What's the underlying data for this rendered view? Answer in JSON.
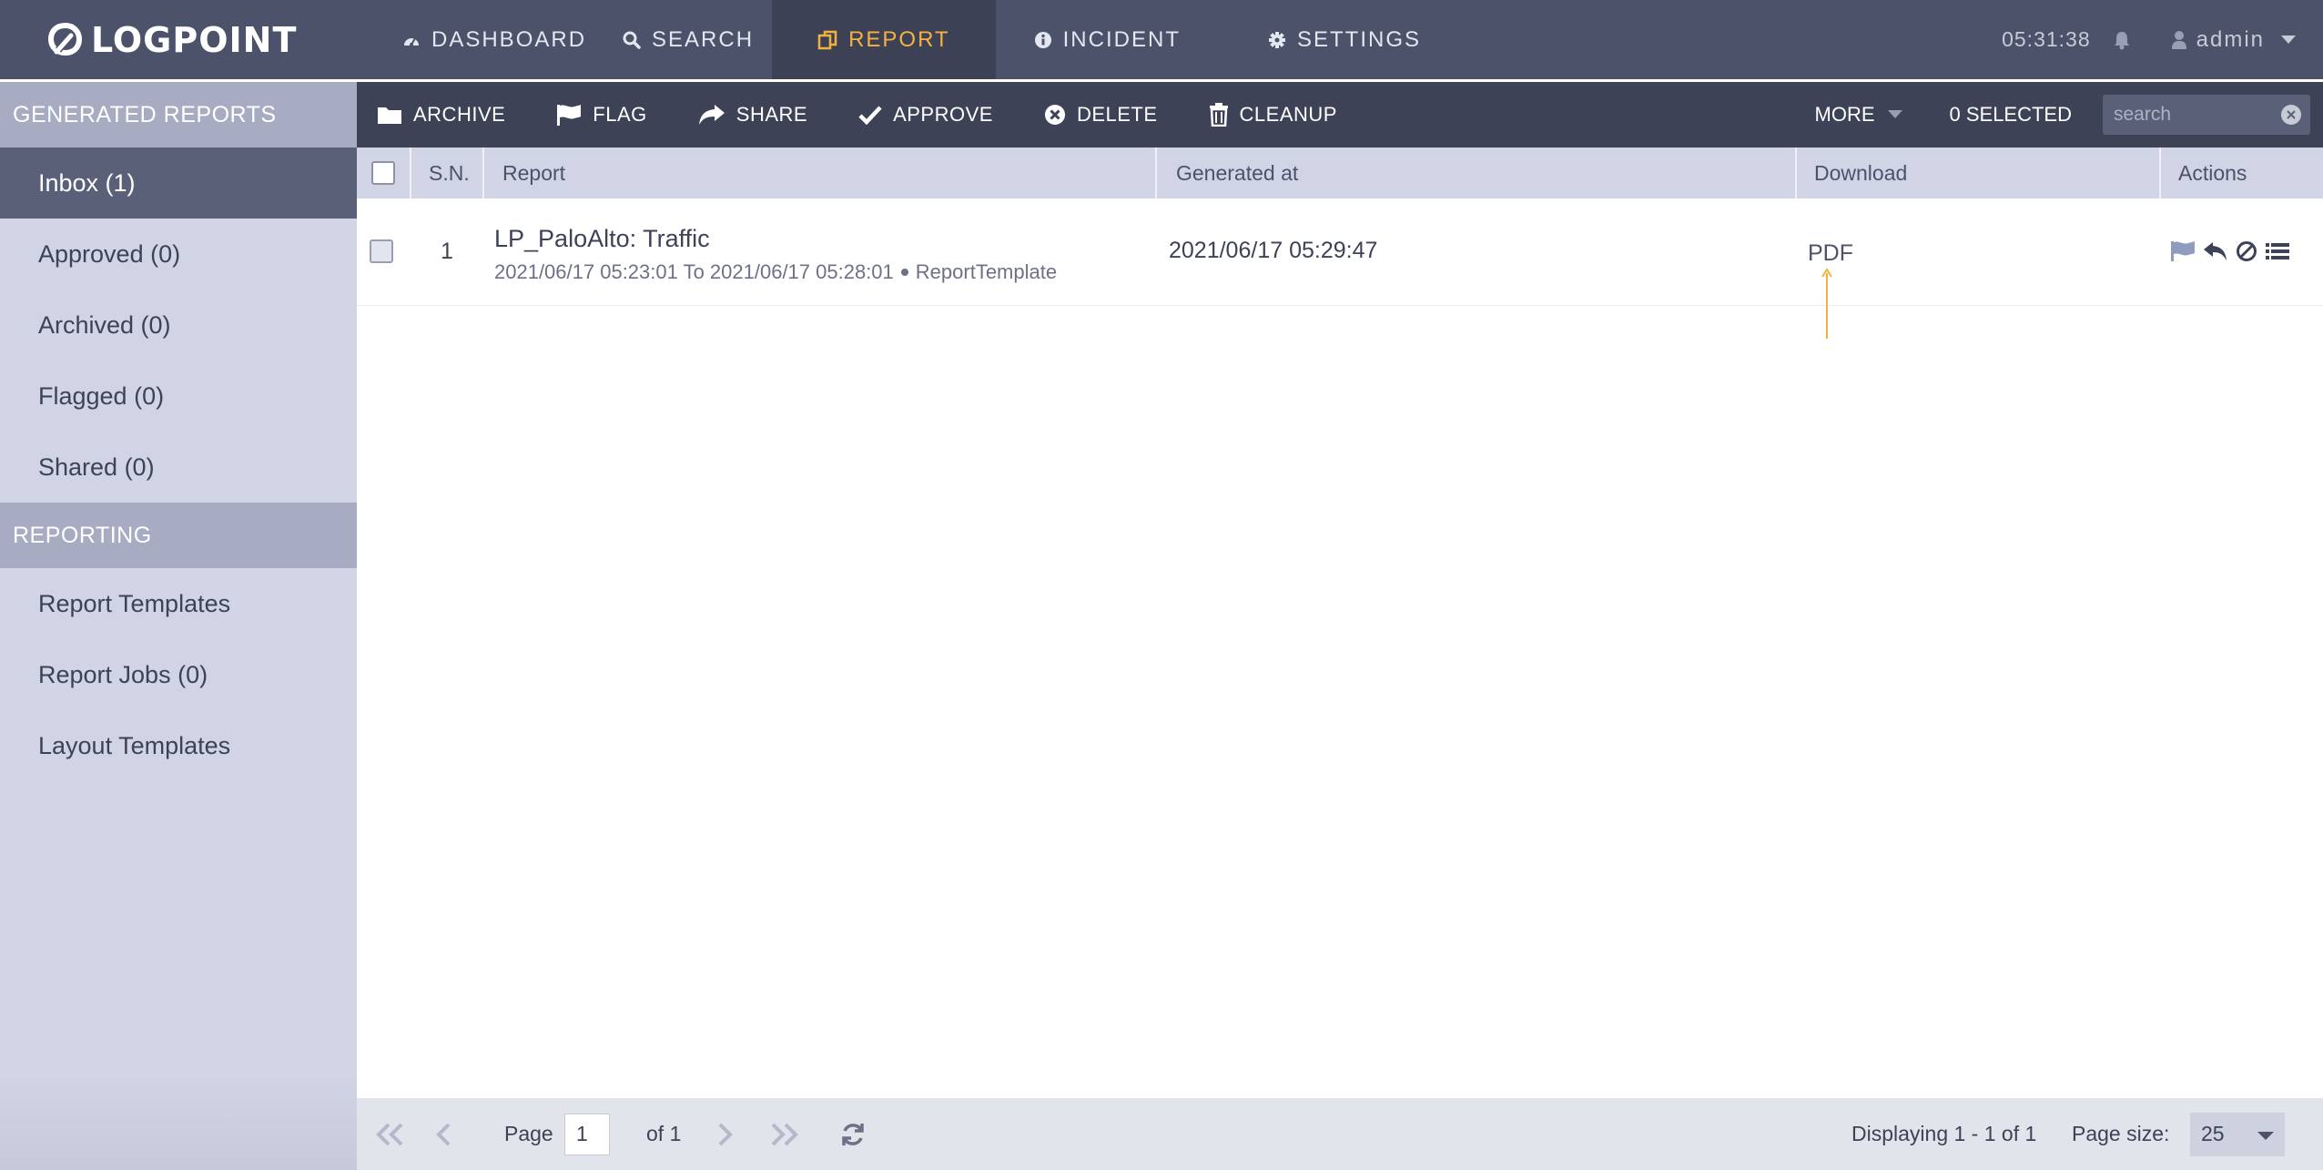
{
  "brand": {
    "name": "LOGPOINT"
  },
  "nav": {
    "items": [
      {
        "label": "DASHBOARD",
        "icon": "dashboard-icon"
      },
      {
        "label": "SEARCH",
        "icon": "search-icon"
      },
      {
        "label": "REPORT",
        "icon": "report-icon",
        "active": true
      },
      {
        "label": "INCIDENT",
        "icon": "info-icon"
      },
      {
        "label": "SETTINGS",
        "icon": "gear-icon"
      }
    ],
    "clock": "05:31:38",
    "user": "admin"
  },
  "sidebar": {
    "section1": "GENERATED REPORTS",
    "items1": [
      {
        "label": "Inbox (1)",
        "active": true
      },
      {
        "label": "Approved (0)"
      },
      {
        "label": "Archived (0)"
      },
      {
        "label": "Flagged (0)"
      },
      {
        "label": "Shared (0)"
      }
    ],
    "section2": "REPORTING",
    "items2": [
      {
        "label": "Report Templates"
      },
      {
        "label": "Report Jobs (0)"
      },
      {
        "label": "Layout Templates"
      }
    ]
  },
  "toolbar": {
    "archive": "ARCHIVE",
    "flag": "FLAG",
    "share": "SHARE",
    "approve": "APPROVE",
    "delete": "DELETE",
    "cleanup": "CLEANUP",
    "more": "MORE",
    "selected": "0 SELECTED",
    "search_placeholder": "search"
  },
  "table": {
    "columns": {
      "sn": "S.N.",
      "report": "Report",
      "generated": "Generated at",
      "download": "Download",
      "actions": "Actions"
    },
    "rows": [
      {
        "sn": "1",
        "name": "LP_PaloAlto: Traffic",
        "range": "2021/06/17 05:23:01 To 2021/06/17 05:28:01",
        "template": "ReportTemplate",
        "generated": "2021/06/17 05:29:47",
        "download": "PDF",
        "action_icons": [
          "flag-icon",
          "reply-icon",
          "block-icon",
          "list-icon"
        ]
      }
    ]
  },
  "colors": {
    "accent": "#f5b13d",
    "nav_bg": "#4d526b",
    "toolbar_bg": "#3e4257",
    "sidebar_bg": "#d1d4e4"
  },
  "pager": {
    "page_label": "Page",
    "page_value": "1",
    "of_label": "of 1",
    "display": "Displaying 1 - 1 of 1",
    "size_label": "Page size:",
    "size_value": "25"
  }
}
